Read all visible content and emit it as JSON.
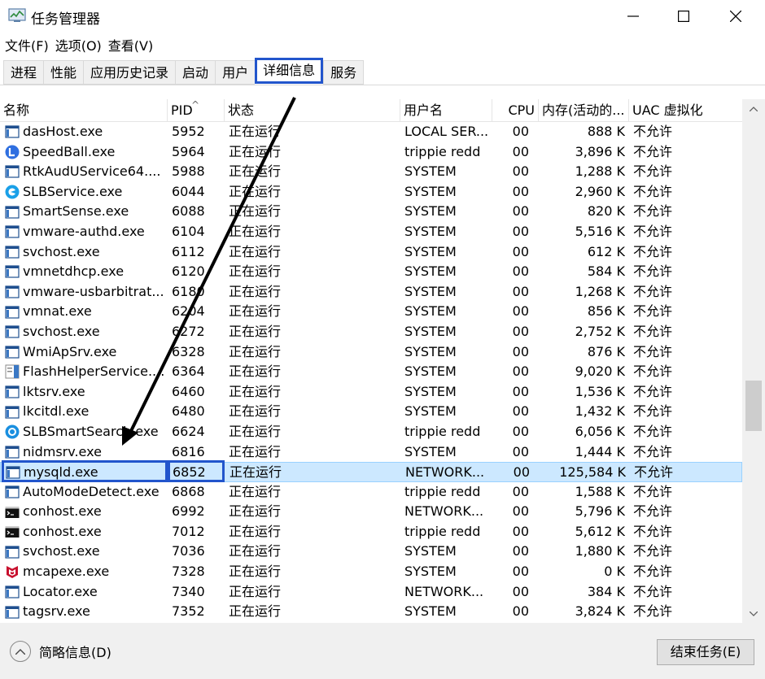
{
  "window": {
    "title": "任务管理器"
  },
  "menu": [
    "文件(F)",
    "选项(O)",
    "查看(V)"
  ],
  "tabs": [
    "进程",
    "性能",
    "应用历史记录",
    "启动",
    "用户",
    "详细信息",
    "服务"
  ],
  "active_tab": "详细信息",
  "columns": {
    "name": "名称",
    "pid": "PID",
    "status": "状态",
    "user": "用户名",
    "cpu": "CPU",
    "memory": "内存(活动的...",
    "uac": "UAC 虚拟化"
  },
  "rows": [
    {
      "name": "dasHost.exe",
      "pid": "5952",
      "status": "正在运行",
      "user": "LOCAL SER...",
      "cpu": "00",
      "mem": "888 K",
      "uac": "不允许",
      "icon": "window-icon"
    },
    {
      "name": "SpeedBall.exe",
      "pid": "5964",
      "status": "正在运行",
      "user": "trippie redd",
      "cpu": "00",
      "mem": "3,896 K",
      "uac": "不允许",
      "icon": "speedball-icon"
    },
    {
      "name": "RtkAudUService64....",
      "pid": "5988",
      "status": "正在运行",
      "user": "SYSTEM",
      "cpu": "00",
      "mem": "1,288 K",
      "uac": "不允许",
      "icon": "window-icon"
    },
    {
      "name": "SLBService.exe",
      "pid": "6044",
      "status": "正在运行",
      "user": "SYSTEM",
      "cpu": "00",
      "mem": "2,960 K",
      "uac": "不允许",
      "icon": "slb-icon"
    },
    {
      "name": "SmartSense.exe",
      "pid": "6088",
      "status": "正在运行",
      "user": "SYSTEM",
      "cpu": "00",
      "mem": "820 K",
      "uac": "不允许",
      "icon": "window-icon"
    },
    {
      "name": "vmware-authd.exe",
      "pid": "6104",
      "status": "正在运行",
      "user": "SYSTEM",
      "cpu": "00",
      "mem": "5,516 K",
      "uac": "不允许",
      "icon": "window-icon"
    },
    {
      "name": "svchost.exe",
      "pid": "6112",
      "status": "正在运行",
      "user": "SYSTEM",
      "cpu": "00",
      "mem": "612 K",
      "uac": "不允许",
      "icon": "window-icon"
    },
    {
      "name": "vmnetdhcp.exe",
      "pid": "6120",
      "status": "正在运行",
      "user": "SYSTEM",
      "cpu": "00",
      "mem": "584 K",
      "uac": "不允许",
      "icon": "window-icon"
    },
    {
      "name": "vmware-usbarbitrat...",
      "pid": "6180",
      "status": "正在运行",
      "user": "SYSTEM",
      "cpu": "00",
      "mem": "1,268 K",
      "uac": "不允许",
      "icon": "window-icon"
    },
    {
      "name": "vmnat.exe",
      "pid": "6204",
      "status": "正在运行",
      "user": "SYSTEM",
      "cpu": "00",
      "mem": "856 K",
      "uac": "不允许",
      "icon": "window-icon"
    },
    {
      "name": "svchost.exe",
      "pid": "6272",
      "status": "正在运行",
      "user": "SYSTEM",
      "cpu": "00",
      "mem": "2,752 K",
      "uac": "不允许",
      "icon": "window-icon"
    },
    {
      "name": "WmiApSrv.exe",
      "pid": "6328",
      "status": "正在运行",
      "user": "SYSTEM",
      "cpu": "00",
      "mem": "876 K",
      "uac": "不允许",
      "icon": "window-icon"
    },
    {
      "name": "FlashHelperService....",
      "pid": "6364",
      "status": "正在运行",
      "user": "SYSTEM",
      "cpu": "00",
      "mem": "9,020 K",
      "uac": "不允许",
      "icon": "flash-icon"
    },
    {
      "name": "lktsrv.exe",
      "pid": "6460",
      "status": "正在运行",
      "user": "SYSTEM",
      "cpu": "00",
      "mem": "1,536 K",
      "uac": "不允许",
      "icon": "window-icon"
    },
    {
      "name": "lkcitdl.exe",
      "pid": "6480",
      "status": "正在运行",
      "user": "SYSTEM",
      "cpu": "00",
      "mem": "1,432 K",
      "uac": "不允许",
      "icon": "window-icon"
    },
    {
      "name": "SLBSmartSearch.exe",
      "pid": "6624",
      "status": "正在运行",
      "user": "trippie redd",
      "cpu": "00",
      "mem": "6,056 K",
      "uac": "不允许",
      "icon": "slbsearch-icon"
    },
    {
      "name": "nidmsrv.exe",
      "pid": "6816",
      "status": "正在运行",
      "user": "SYSTEM",
      "cpu": "00",
      "mem": "1,444 K",
      "uac": "不允许",
      "icon": "window-icon"
    },
    {
      "name": "mysqld.exe",
      "pid": "6852",
      "status": "正在运行",
      "user": "NETWORK...",
      "cpu": "00",
      "mem": "125,584 K",
      "uac": "不允许",
      "icon": "window-icon"
    },
    {
      "name": "AutoModeDetect.exe",
      "pid": "6868",
      "status": "正在运行",
      "user": "trippie redd",
      "cpu": "00",
      "mem": "1,588 K",
      "uac": "不允许",
      "icon": "window-icon"
    },
    {
      "name": "conhost.exe",
      "pid": "6992",
      "status": "正在运行",
      "user": "NETWORK...",
      "cpu": "00",
      "mem": "5,796 K",
      "uac": "不允许",
      "icon": "console-icon"
    },
    {
      "name": "conhost.exe",
      "pid": "7012",
      "status": "正在运行",
      "user": "trippie redd",
      "cpu": "00",
      "mem": "5,612 K",
      "uac": "不允许",
      "icon": "console-icon"
    },
    {
      "name": "svchost.exe",
      "pid": "7036",
      "status": "正在运行",
      "user": "SYSTEM",
      "cpu": "00",
      "mem": "1,880 K",
      "uac": "不允许",
      "icon": "window-icon"
    },
    {
      "name": "mcapexe.exe",
      "pid": "7328",
      "status": "正在运行",
      "user": "SYSTEM",
      "cpu": "00",
      "mem": "0 K",
      "uac": "不允许",
      "icon": "mcafee-icon"
    },
    {
      "name": "Locator.exe",
      "pid": "7340",
      "status": "正在运行",
      "user": "NETWORK...",
      "cpu": "00",
      "mem": "384 K",
      "uac": "不允许",
      "icon": "window-icon"
    },
    {
      "name": "tagsrv.exe",
      "pid": "7352",
      "status": "正在运行",
      "user": "SYSTEM",
      "cpu": "00",
      "mem": "3,824 K",
      "uac": "不允许",
      "icon": "window-icon"
    }
  ],
  "selected_row": "mysqld.exe",
  "footer": {
    "less_details": "简略信息(D)",
    "end_task": "结束任务(E)"
  },
  "colors": {
    "highlight": "#2255cc",
    "selected_row": "#cce8ff"
  }
}
